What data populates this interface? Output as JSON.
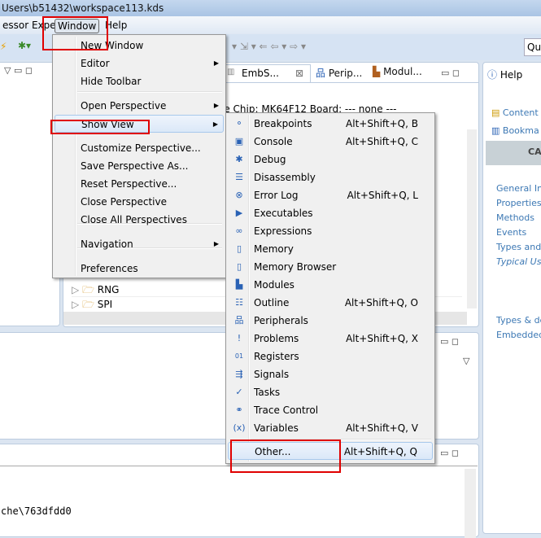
{
  "window": {
    "title": "Users\\b51432\\workspace113.kds"
  },
  "menubar": {
    "items": [
      "essor Expert",
      "Window",
      "Help"
    ]
  },
  "toolbar": {
    "quick_access": "Qui"
  },
  "editor": {
    "tabs": [
      {
        "label": "EmbS...",
        "icon": "embsys-icon"
      },
      {
        "label": "Perip...",
        "icon": "peripherals-icon"
      },
      {
        "label": "Modul...",
        "icon": "modules-icon"
      }
    ],
    "header": "le  Chip: MK64F12  Board: ---  none ---",
    "tree": [
      "RNG",
      "SPI"
    ]
  },
  "help": {
    "tab": "Help",
    "links": [
      "Content",
      "Bookma"
    ],
    "banner": "CA",
    "items": [
      "General Inf",
      "Properties",
      "Methods",
      "Events",
      "Types and",
      "Typical Usa"
    ],
    "items2": [
      "Types & de",
      "Embedded"
    ]
  },
  "console": {
    "line": "che\\763dfdd0"
  },
  "window_menu": {
    "items": [
      {
        "label": "New Window"
      },
      {
        "label": "Editor",
        "submenu": true
      },
      {
        "label": "Hide Toolbar"
      },
      {
        "label": "Open Perspective",
        "submenu": true
      },
      {
        "label": "Show View",
        "submenu": true,
        "highlighted": true
      },
      {
        "label": "Customize Perspective..."
      },
      {
        "label": "Save Perspective As..."
      },
      {
        "label": "Reset Perspective..."
      },
      {
        "label": "Close Perspective"
      },
      {
        "label": "Close All Perspectives"
      },
      {
        "label": "Navigation",
        "submenu": true
      },
      {
        "label": "Preferences"
      }
    ]
  },
  "show_view_menu": {
    "items": [
      {
        "label": "Breakpoints",
        "shortcut": "Alt+Shift+Q, B",
        "icon": "breakpoints-icon"
      },
      {
        "label": "Console",
        "shortcut": "Alt+Shift+Q, C",
        "icon": "console-icon"
      },
      {
        "label": "Debug",
        "shortcut": "",
        "icon": "debug-bug-icon"
      },
      {
        "label": "Disassembly",
        "shortcut": "",
        "icon": "disassembly-icon"
      },
      {
        "label": "Error Log",
        "shortcut": "Alt+Shift+Q, L",
        "icon": "error-log-icon"
      },
      {
        "label": "Executables",
        "shortcut": "",
        "icon": "executables-icon"
      },
      {
        "label": "Expressions",
        "shortcut": "",
        "icon": "expressions-icon"
      },
      {
        "label": "Memory",
        "shortcut": "",
        "icon": "memory-icon"
      },
      {
        "label": "Memory Browser",
        "shortcut": "",
        "icon": "memory-browser-icon"
      },
      {
        "label": "Modules",
        "shortcut": "",
        "icon": "modules-icon"
      },
      {
        "label": "Outline",
        "shortcut": "Alt+Shift+Q, O",
        "icon": "outline-icon"
      },
      {
        "label": "Peripherals",
        "shortcut": "",
        "icon": "peripherals-icon"
      },
      {
        "label": "Problems",
        "shortcut": "Alt+Shift+Q, X",
        "icon": "problems-icon"
      },
      {
        "label": "Registers",
        "shortcut": "",
        "icon": "registers-icon"
      },
      {
        "label": "Signals",
        "shortcut": "",
        "icon": "signals-icon"
      },
      {
        "label": "Tasks",
        "shortcut": "",
        "icon": "tasks-icon"
      },
      {
        "label": "Trace Control",
        "shortcut": "",
        "icon": "trace-control-icon"
      },
      {
        "label": "Variables",
        "shortcut": "Alt+Shift+Q, V",
        "icon": "variables-icon"
      },
      {
        "label": "Other...",
        "shortcut": "Alt+Shift+Q, Q",
        "icon": "",
        "highlighted": true
      }
    ]
  },
  "colors": {
    "highlight_box": "#e00000",
    "link": "#3c78b4"
  }
}
